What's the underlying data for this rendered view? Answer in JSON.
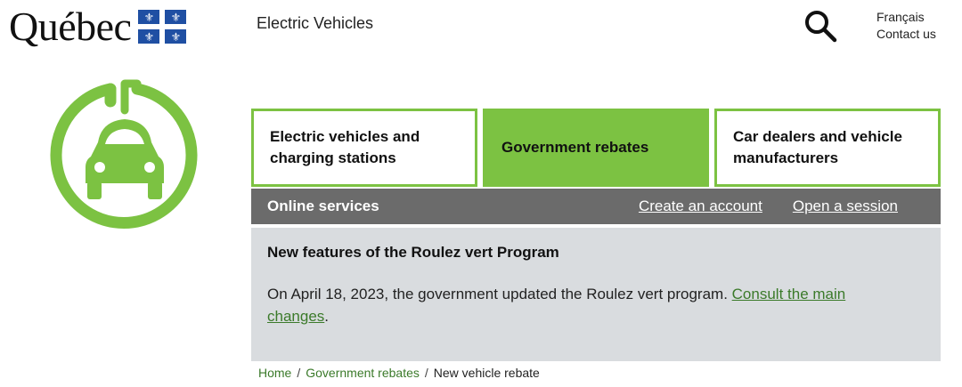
{
  "header": {
    "brand": "Québec",
    "site_title": "Electric Vehicles",
    "language_link": "Français",
    "contact_link": "Contact us"
  },
  "tiles": [
    {
      "line1": "Electric vehicles and",
      "line2": "charging stations"
    },
    {
      "line1": "Government rebates",
      "line2": ""
    },
    {
      "line1": "Car dealers and vehicle",
      "line2": "manufacturers"
    }
  ],
  "services": {
    "label": "Online services",
    "create_account": "Create an account",
    "open_session": "Open a session"
  },
  "news": {
    "title": "New features of the Roulez vert Program",
    "text": "On April 18, 2023, the government updated the Roulez vert program. ",
    "link": "Consult the main changes",
    "end": "."
  },
  "breadcrumb": {
    "home": "Home",
    "section": "Government rebates",
    "current": "New vehicle rebate",
    "separator": "/"
  },
  "colors": {
    "accent_green": "#7cc242",
    "services_bar": "#6b6b6b",
    "news_bg": "#d9dcdf",
    "link_green": "#3b7a2a",
    "flag_blue": "#1f4fa3"
  }
}
